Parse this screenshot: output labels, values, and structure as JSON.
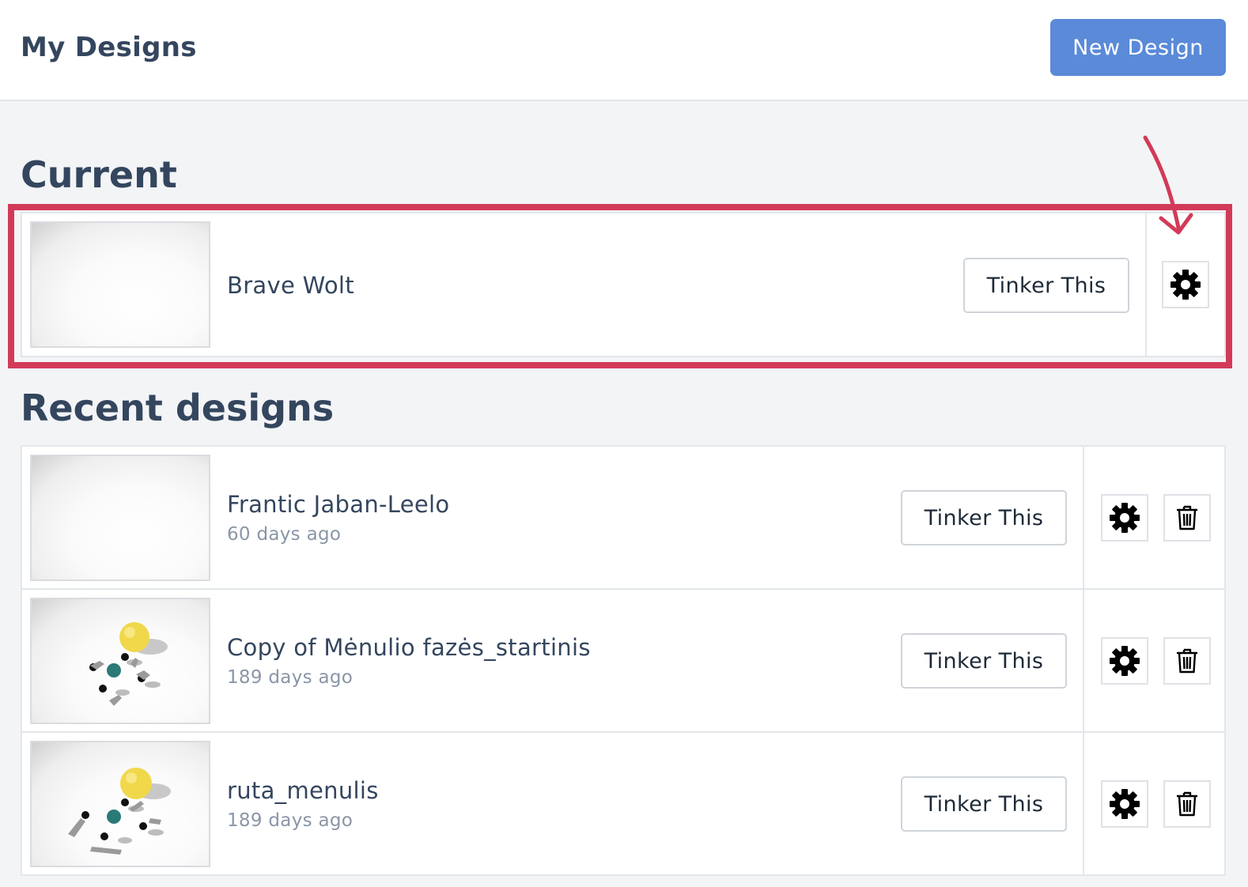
{
  "header": {
    "title": "My Designs",
    "new_design_label": "New Design"
  },
  "sections": {
    "current_title": "Current",
    "recent_title": "Recent designs"
  },
  "current_design": {
    "name": "Brave Wolt",
    "tinker_label": "Tinker This",
    "settings_icon": "gear-icon"
  },
  "recent_designs": [
    {
      "name": "Frantic Jaban-Leelo",
      "age": "60 days ago",
      "tinker_label": "Tinker This",
      "settings_icon": "gear-icon",
      "delete_icon": "trash-icon"
    },
    {
      "name": "Copy of Mėnulio fazės_startinis",
      "age": "189 days ago",
      "tinker_label": "Tinker This",
      "settings_icon": "gear-icon",
      "delete_icon": "trash-icon"
    },
    {
      "name": "ruta_menulis",
      "age": "189 days ago",
      "tinker_label": "Tinker This",
      "settings_icon": "gear-icon",
      "delete_icon": "trash-icon"
    }
  ],
  "colors": {
    "accent": "#5a8ad8",
    "highlight": "#d23a58",
    "text": "#34465e",
    "muted": "#8a96a6"
  }
}
